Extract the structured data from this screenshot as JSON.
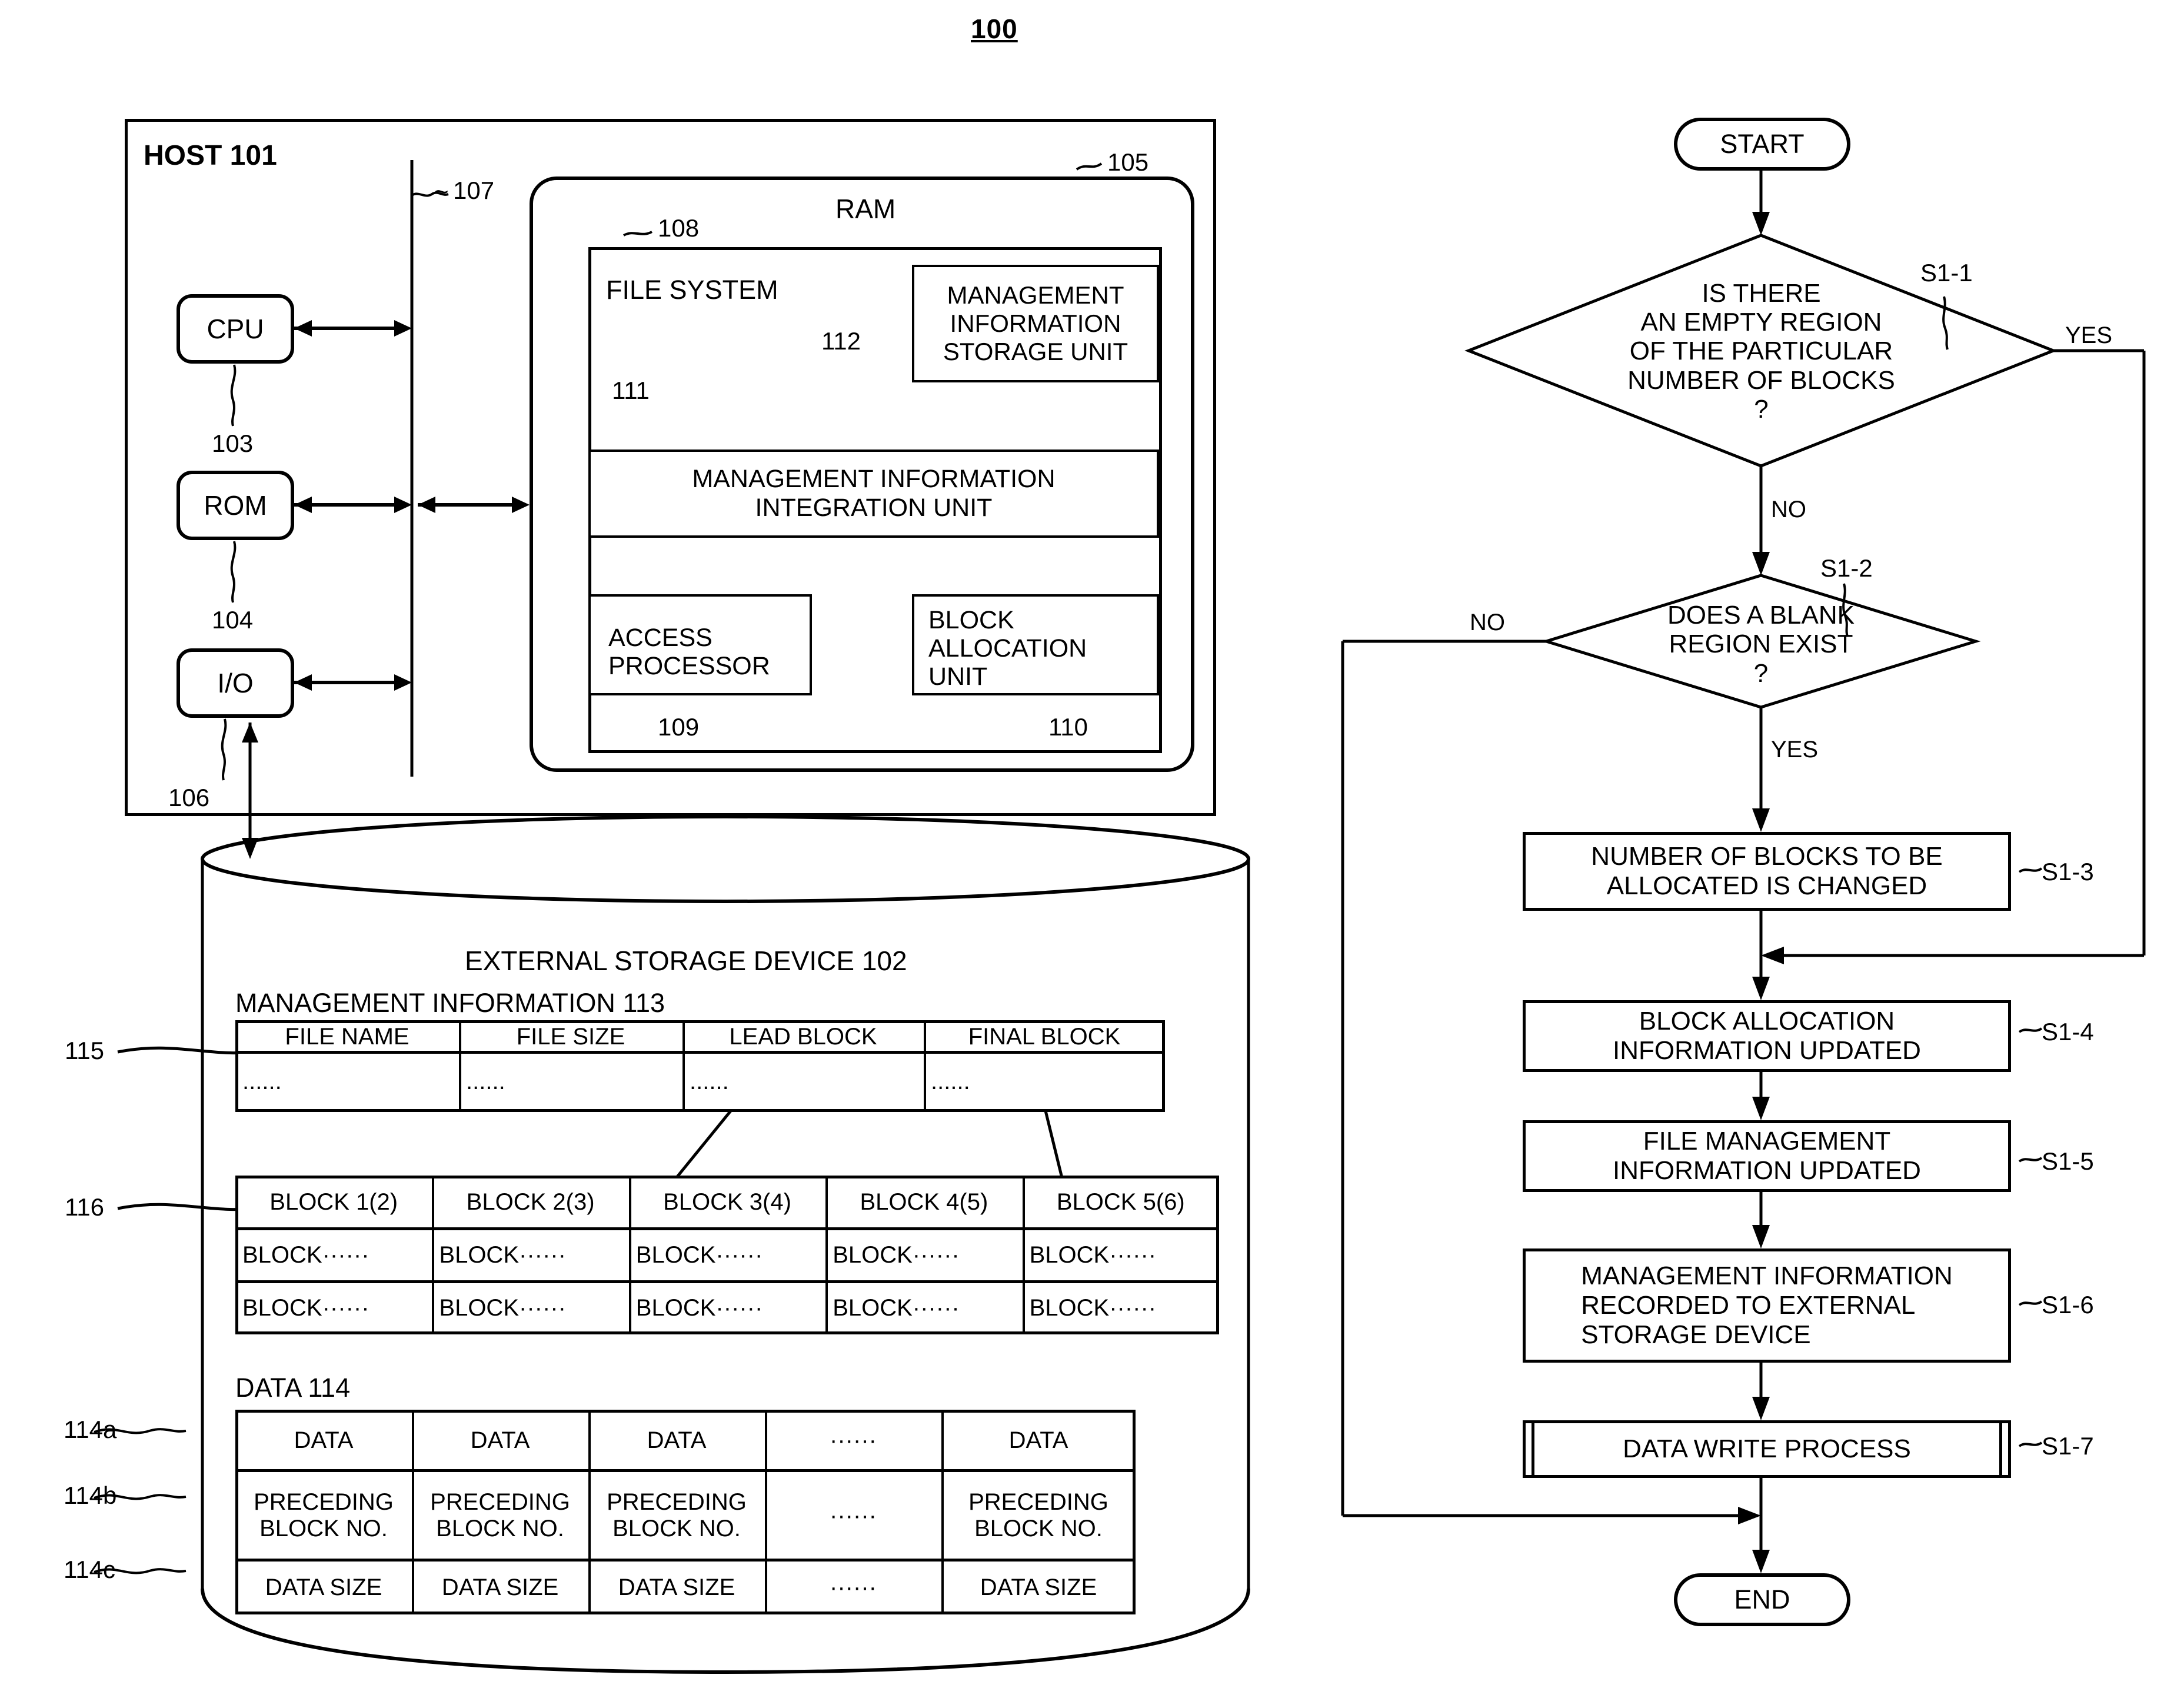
{
  "figure": {
    "number": "100"
  },
  "host": {
    "title": "HOST 101",
    "bus_ref": "107",
    "components": [
      {
        "label": "CPU",
        "ref": "103"
      },
      {
        "label": "ROM",
        "ref": "104"
      },
      {
        "label": "I/O",
        "ref": "106"
      }
    ],
    "ram": {
      "title": "RAM",
      "ref": "105",
      "file_system": {
        "title": "FILE SYSTEM",
        "ref": "108",
        "units": [
          {
            "label": "MANAGEMENT\nINFORMATION\nSTORAGE UNIT",
            "ref": "112"
          },
          {
            "label": "MANAGEMENT INFORMATION\nINTEGRATION UNIT",
            "ref": "111"
          },
          {
            "label": "ACCESS\nPROCESSOR",
            "ref": "109"
          },
          {
            "label": "BLOCK\nALLOCATION\nUNIT",
            "ref": "110"
          }
        ]
      }
    }
  },
  "storage": {
    "title": "EXTERNAL STORAGE DEVICE 102",
    "management_information": {
      "title": "MANAGEMENT INFORMATION 113",
      "ref": "115",
      "headers": [
        "FILE NAME",
        "FILE SIZE",
        "LEAD BLOCK",
        "FINAL BLOCK"
      ],
      "values": [
        "......",
        "......",
        "......",
        "......"
      ]
    },
    "block_table": {
      "ref": "116",
      "header_row": [
        "BLOCK 1(2)",
        "BLOCK 2(3)",
        "BLOCK 3(4)",
        "BLOCK 4(5)",
        "BLOCK 5(6)"
      ],
      "row2": [
        "BLOCK······",
        "BLOCK······",
        "BLOCK······",
        "BLOCK······",
        "BLOCK······"
      ],
      "row3": [
        "BLOCK······",
        "BLOCK······",
        "BLOCK······",
        "BLOCK······",
        "BLOCK······"
      ]
    },
    "data_table": {
      "title": "DATA 114",
      "row_refs": [
        "114a",
        "114b",
        "114c"
      ],
      "row1": [
        "DATA",
        "DATA",
        "DATA",
        "······",
        "DATA"
      ],
      "row2": [
        "PRECEDING\nBLOCK NO.",
        "PRECEDING\nBLOCK NO.",
        "PRECEDING\nBLOCK NO.",
        "······",
        "PRECEDING\nBLOCK NO."
      ],
      "row3": [
        "DATA SIZE",
        "DATA SIZE",
        "DATA SIZE",
        "······",
        "DATA SIZE"
      ]
    }
  },
  "flowchart": {
    "start": "START",
    "end": "END",
    "nodes": [
      {
        "id": "S1-1",
        "type": "decision",
        "text": "IS THERE\nAN EMPTY REGION\nOF THE PARTICULAR\nNUMBER OF BLOCKS\n?",
        "yes": "YES",
        "no": "NO"
      },
      {
        "id": "S1-2",
        "type": "decision",
        "text": "DOES A BLANK\nREGION EXIST\n?",
        "yes": "YES",
        "no": "NO"
      },
      {
        "id": "S1-3",
        "type": "process",
        "text": "NUMBER OF BLOCKS TO BE\nALLOCATED IS CHANGED"
      },
      {
        "id": "S1-4",
        "type": "process",
        "text": "BLOCK ALLOCATION\nINFORMATION UPDATED"
      },
      {
        "id": "S1-5",
        "type": "process",
        "text": "FILE MANAGEMENT\nINFORMATION UPDATED"
      },
      {
        "id": "S1-6",
        "type": "process",
        "text": "MANAGEMENT INFORMATION\nRECORDED TO EXTERNAL\nSTORAGE DEVICE"
      },
      {
        "id": "S1-7",
        "type": "predefined-process",
        "text": "DATA WRITE PROCESS"
      }
    ]
  }
}
